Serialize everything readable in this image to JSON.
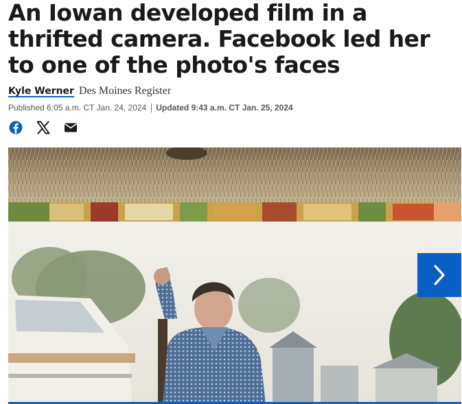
{
  "article": {
    "headline": "An Iowan developed film in a thrifted camera. Facebook led her to one of the photo's faces",
    "author": "Kyle Werner",
    "organization": "Des Moines Register",
    "published": "Published 6:05 a.m. CT Jan. 24, 2024",
    "updated": "Updated 9:43 a.m. CT Jan. 25, 2024"
  },
  "share": {
    "icons": [
      "facebook-icon",
      "x-icon",
      "email-icon"
    ]
  },
  "gallery": {
    "next_icon": "chevron-right-icon"
  },
  "colors": {
    "accent": "#0a5ec4",
    "text": "#1a1a1a"
  }
}
